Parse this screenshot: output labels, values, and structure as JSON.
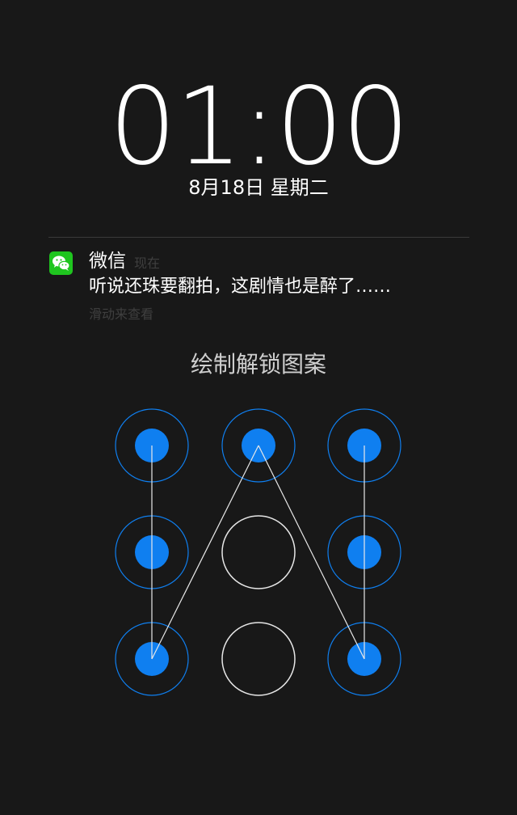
{
  "lockscreen": {
    "time": "01:00",
    "date": "8月18日 星期二"
  },
  "notification": {
    "app_name": "微信",
    "time": "现在",
    "message": "听说还珠要翻拍，这剧情也是醉了……",
    "hint": "滑动来查看",
    "icon": "wechat-icon"
  },
  "pattern": {
    "title": "绘制解锁图案",
    "accent_color": "#0f7ff0",
    "nodes": [
      {
        "id": 1,
        "active": true
      },
      {
        "id": 2,
        "active": true
      },
      {
        "id": 3,
        "active": true
      },
      {
        "id": 4,
        "active": true
      },
      {
        "id": 5,
        "active": false
      },
      {
        "id": 6,
        "active": true
      },
      {
        "id": 7,
        "active": true
      },
      {
        "id": 8,
        "active": false
      },
      {
        "id": 9,
        "active": true
      }
    ],
    "sequence": [
      1,
      4,
      7,
      2,
      9,
      6,
      3
    ]
  }
}
